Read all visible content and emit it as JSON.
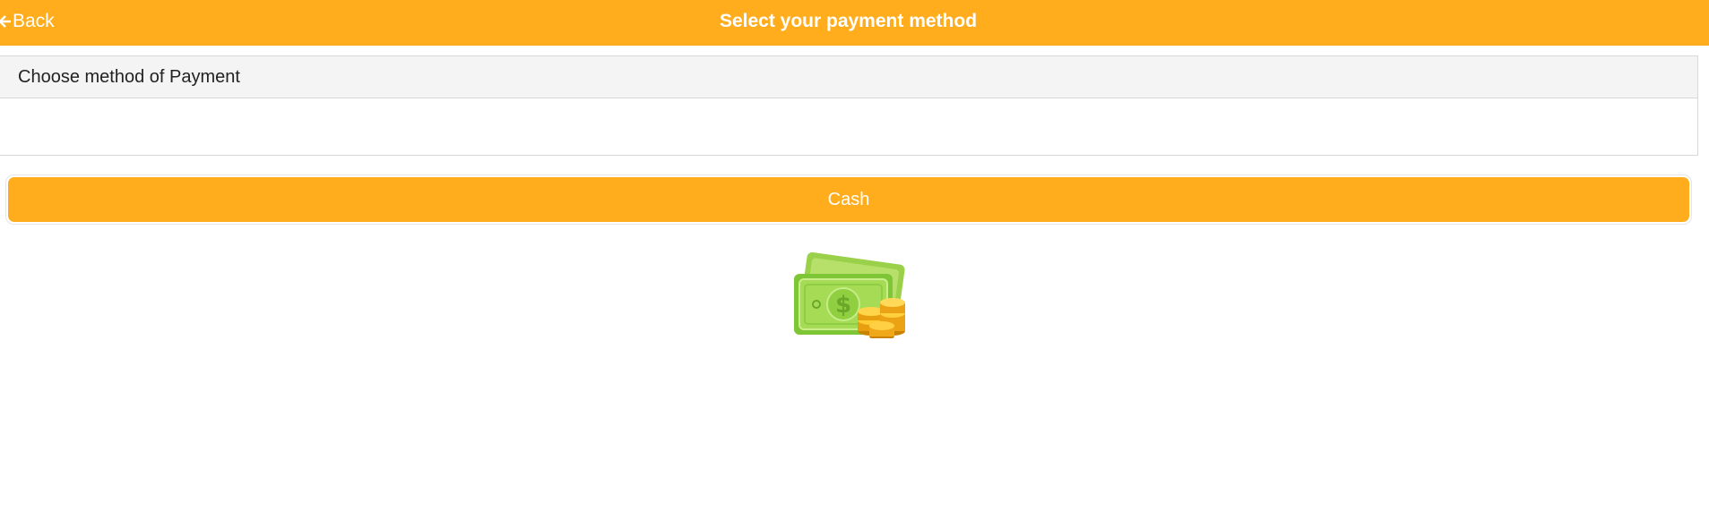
{
  "header": {
    "back_label": "Back",
    "title": "Select your payment method",
    "background_color": "#ffad1d"
  },
  "panel": {
    "heading": "Choose method of Payment"
  },
  "payment_options": [
    {
      "label": "Cash",
      "icon": "cash-money-icon"
    }
  ],
  "colors": {
    "accent": "#ffad1d",
    "panel_header_bg": "#f4f4f4",
    "text_dark": "#222222"
  }
}
